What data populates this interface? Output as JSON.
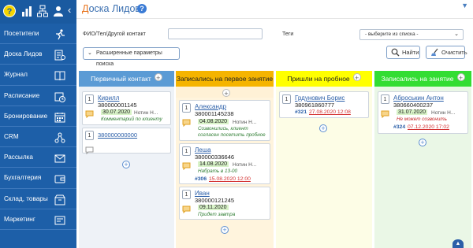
{
  "header": {
    "title_first": "Д",
    "title_rest": "оска Лидов",
    "help": "?"
  },
  "sidebar": {
    "help": "?",
    "items": [
      {
        "label": "Посетители",
        "icon": "running-person-icon"
      },
      {
        "label": "Доска Лидов",
        "icon": "leads-board-icon"
      },
      {
        "label": "Журнал",
        "icon": "book-icon"
      },
      {
        "label": "Расписание",
        "icon": "schedule-icon"
      },
      {
        "label": "Бронирование",
        "icon": "calendar-icon"
      },
      {
        "label": "CRM",
        "icon": "hierarchy-icon"
      },
      {
        "label": "Рассылка",
        "icon": "mail-icon"
      },
      {
        "label": "Бухгалтерия",
        "icon": "wallet-icon"
      },
      {
        "label": "Склад, товары",
        "icon": "box-icon"
      },
      {
        "label": "Маркетинг",
        "icon": "marketing-icon"
      }
    ]
  },
  "filters": {
    "contact_label": "ФИО/Тел/Другой контакт",
    "contact_value": "",
    "tags_label": "Теги",
    "tags_select": "- выберите из списка -",
    "advanced": "Расширенные параметры поиска",
    "find": "Найти",
    "clear": "Очистить"
  },
  "columns": [
    {
      "title": "Первичный контакт",
      "color": "#5b9bd5",
      "cards": [
        {
          "num": "1",
          "name": "Кирилл",
          "phone": "380000001145",
          "date": "30.07.2020",
          "who": "Нотин Н...",
          "note": "Комментарий по клиенту",
          "note_red": false
        },
        {
          "num": "1",
          "name": "",
          "phone": "380000000000"
        }
      ]
    },
    {
      "title": "Записались на первое занятие",
      "color": "#f5b400",
      "cards": [
        {
          "num": "1",
          "name": "Александр",
          "phone": "380001145238",
          "date": "04.08.2020",
          "who": "Нотин Н...",
          "note": "Созвонились, клиент согласен посетить пробное"
        },
        {
          "num": "1",
          "name": "Леша",
          "phone": "380000336646",
          "date": "14.08.2020",
          "who": "Нотин Н...",
          "note": "Набрать в 13-00",
          "tag": "#306",
          "tagdate": "15.08.2020 12:00"
        },
        {
          "num": "1",
          "name": "Иван",
          "phone": "380000121245",
          "date": "09.11.2020",
          "who": "",
          "note": "Придет завтра"
        }
      ]
    },
    {
      "title": "Пришли на пробное",
      "color": "#ffff00",
      "cards": [
        {
          "num": "1",
          "name": "Грдунович Борис",
          "phone": "380961860777",
          "tag": "#321",
          "tagdate": "27.08.2020 12:08"
        }
      ]
    },
    {
      "title": "Записались на занятие",
      "color": "#33dd33",
      "cards": [
        {
          "num": "1",
          "name": "Аброськин Антон",
          "phone": "380660400237",
          "date": "31.07.2020",
          "who": "Нотин Н...",
          "note": "Не может созвонить",
          "tag": "#324",
          "tagdate": "07.12.2020 17:02"
        }
      ]
    }
  ],
  "colors": {
    "sidebar": "#1d5fa8",
    "accent": "#3a6fb0",
    "title_first": "#e8741e"
  }
}
